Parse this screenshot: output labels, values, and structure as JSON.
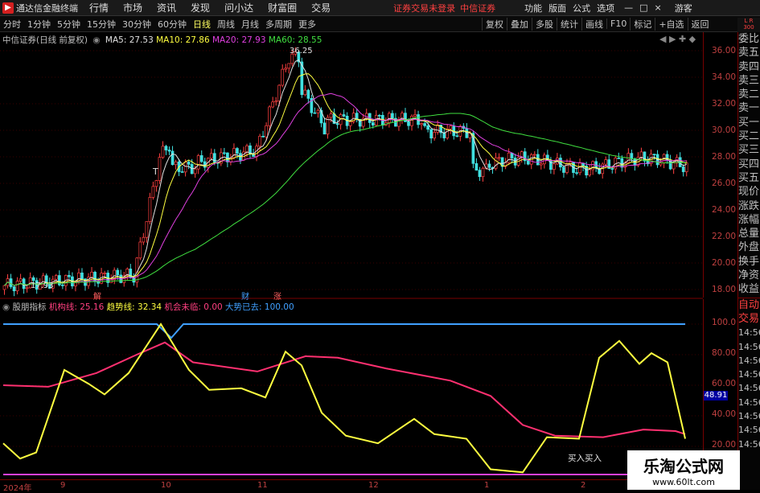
{
  "app": {
    "title": "通达信金融终端",
    "menu": [
      "行情",
      "市场",
      "资讯",
      "发现",
      "问小达",
      "财富圈",
      "交易"
    ],
    "status": [
      "证券交易未登录",
      "中信证券"
    ],
    "right_menu": [
      "功能",
      "版面",
      "公式",
      "选项"
    ],
    "guest": "游客"
  },
  "periods": [
    "分时",
    "1分钟",
    "5分钟",
    "15分钟",
    "30分钟",
    "60分钟",
    "日线",
    "周线",
    "月线",
    "多周期",
    "更多"
  ],
  "active_period": "日线",
  "tools": [
    "复权",
    "叠加",
    "多股",
    "统计",
    "画线",
    "F10",
    "标记",
    "+自选",
    "返回"
  ],
  "stock": {
    "name": "中信证券(日线 前复权)",
    "ma": [
      {
        "label": "MA5: 27.53",
        "color": "#e0e0e0"
      },
      {
        "label": "MA10: 27.86",
        "color": "#ffff40"
      },
      {
        "label": "MA20: 27.93",
        "color": "#e040e0"
      },
      {
        "label": "MA60: 28.55",
        "color": "#40e040"
      }
    ]
  },
  "indicator": {
    "name": "股朋指标",
    "items": [
      {
        "label": "机构线: 25.16",
        "color": "#ff4080"
      },
      {
        "label": "趋势线: 32.34",
        "color": "#ffff40"
      },
      {
        "label": "机会未临: 0.00",
        "color": "#ff4080"
      },
      {
        "label": "大势已去: 100.00",
        "color": "#40a0ff"
      }
    ],
    "value_badge": "48.91",
    "buy_text": "买入买入"
  },
  "right_panel": [
    "委比",
    "卖五",
    "卖四",
    "卖三",
    "卖二",
    "卖一",
    "买一",
    "买二",
    "买三",
    "买四",
    "买五",
    "现价",
    "涨跌",
    "涨幅",
    "总量",
    "外盘",
    "换手",
    "净资",
    "收益"
  ],
  "right_panel2": [
    "自动",
    "交易",
    "14:56",
    "14:56",
    "14:56",
    "14:56",
    "14:56",
    "14:56",
    "14:56",
    "14:56",
    "14:56"
  ],
  "badge": "L\nR\n300",
  "scale1": [
    "36.00",
    "34.00",
    "32.00",
    "30.00",
    "28.00",
    "26.00",
    "24.00",
    "22.00",
    "20.00",
    "18.00"
  ],
  "scale2": [
    "100.0",
    "80.00",
    "60.00",
    "40.00",
    "20.00"
  ],
  "dates": [
    "2024年",
    "9",
    "10",
    "11",
    "12",
    "1",
    "2"
  ],
  "price_labels": {
    "high": "36.25",
    "low": "17.93"
  },
  "events": [
    "解",
    "财",
    "涨"
  ],
  "watermark": {
    "title": "乐淘公式网",
    "url": "www.60lt.com"
  }
}
